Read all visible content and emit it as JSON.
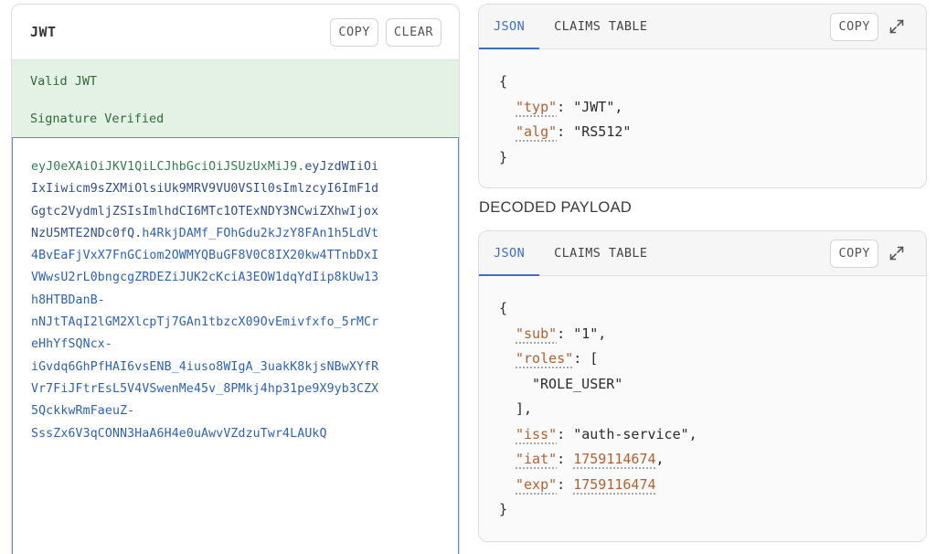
{
  "jwt_panel": {
    "title": "JWT",
    "copy_label": "COPY",
    "clear_label": "CLEAR",
    "status_valid": "Valid JWT",
    "status_signature": "Signature Verified",
    "token_lines": [
      {
        "parts": [
          {
            "text": "eyJ0eXAiOiJKV1QiLCJhbGciOiJSUzUxMiJ9",
            "kind": "header"
          },
          {
            "text": ".",
            "kind": "dot"
          },
          {
            "text": "eyJzdWIiOi",
            "kind": "payload"
          }
        ]
      },
      {
        "parts": [
          {
            "text": "IxIiwicm9sZXMiOlsiUk9MRV9VU0VSIl0sImlzcyI6ImF1d",
            "kind": "payload"
          }
        ]
      },
      {
        "parts": [
          {
            "text": "Ggtc2VydmljZSIsImlhdCI6MTc1OTExNDY3NCwiZXhwIjox",
            "kind": "payload"
          }
        ]
      },
      {
        "parts": [
          {
            "text": "NzU5MTE2NDc0fQ",
            "kind": "payload"
          },
          {
            "text": ".",
            "kind": "dot"
          },
          {
            "text": "h4RkjDAMf_FOhGdu2kJzY8FAn1h5LdVt",
            "kind": "sig"
          }
        ]
      },
      {
        "parts": [
          {
            "text": "4BvEaFjVxX7FnGCiom2OWMYQBuGF8V0C8IX20kw4TTnbDxI",
            "kind": "sig"
          }
        ]
      },
      {
        "parts": [
          {
            "text": "VWwsU2rL0bngcgZRDEZiJUK2cKciA3EOW1dqYdIip8kUw13",
            "kind": "sig"
          }
        ]
      },
      {
        "parts": [
          {
            "text": "h8HTBDanB-",
            "kind": "sig"
          }
        ]
      },
      {
        "parts": [
          {
            "text": "nNJtTAqI2lGM2XlcpTj7GAn1tbzcX09OvEmivfxfo_5rMCr",
            "kind": "sig"
          }
        ]
      },
      {
        "parts": [
          {
            "text": "eHhYfSQNcx-",
            "kind": "sig"
          }
        ]
      },
      {
        "parts": [
          {
            "text": "iGvdq6GhPfHAI6vsENB_4iuso8WIgA_3uakK8kjsNBwXYfR",
            "kind": "sig"
          }
        ]
      },
      {
        "parts": [
          {
            "text": "Vr7FiJFtrEsL5V4VSwenMe45v_8PMkj4hp31pe9X9yb3CZX",
            "kind": "sig"
          }
        ]
      },
      {
        "parts": [
          {
            "text": "5QckkwRmFaeuZ-",
            "kind": "sig"
          }
        ]
      },
      {
        "parts": [
          {
            "text": "SssZx6V3qCONN3HaA6H4e0uAwvVZdzuTwr4LAUkQ",
            "kind": "sig"
          }
        ]
      }
    ]
  },
  "header_card": {
    "tabs": [
      {
        "label": "JSON",
        "active": true
      },
      {
        "label": "CLAIMS TABLE",
        "active": false
      }
    ],
    "copy_label": "COPY",
    "lines": [
      {
        "indent": 0,
        "segs": [
          {
            "t": "{",
            "c": "p"
          }
        ]
      },
      {
        "indent": 1,
        "segs": [
          {
            "t": "\"typ\"",
            "c": "k"
          },
          {
            "t": ": \"JWT\",",
            "c": "p"
          }
        ]
      },
      {
        "indent": 1,
        "segs": [
          {
            "t": "\"alg\"",
            "c": "k"
          },
          {
            "t": ": \"RS512\"",
            "c": "p"
          }
        ]
      },
      {
        "indent": 0,
        "segs": [
          {
            "t": "}",
            "c": "p"
          }
        ]
      }
    ]
  },
  "payload_section_label": "DECODED PAYLOAD",
  "payload_card": {
    "tabs": [
      {
        "label": "JSON",
        "active": true
      },
      {
        "label": "CLAIMS TABLE",
        "active": false
      }
    ],
    "copy_label": "COPY",
    "lines": [
      {
        "indent": 0,
        "segs": [
          {
            "t": "{",
            "c": "p"
          }
        ]
      },
      {
        "indent": 1,
        "segs": [
          {
            "t": "\"sub\"",
            "c": "k"
          },
          {
            "t": ": \"1\",",
            "c": "p"
          }
        ]
      },
      {
        "indent": 1,
        "segs": [
          {
            "t": "\"roles\"",
            "c": "k"
          },
          {
            "t": ": [",
            "c": "p"
          }
        ]
      },
      {
        "indent": 2,
        "segs": [
          {
            "t": "\"ROLE_USER\"",
            "c": "p"
          }
        ]
      },
      {
        "indent": 1,
        "segs": [
          {
            "t": "],",
            "c": "p"
          }
        ]
      },
      {
        "indent": 1,
        "segs": [
          {
            "t": "\"iss\"",
            "c": "k"
          },
          {
            "t": ": \"auth-service\",",
            "c": "p"
          }
        ]
      },
      {
        "indent": 1,
        "segs": [
          {
            "t": "\"iat\"",
            "c": "k"
          },
          {
            "t": ": ",
            "c": "p"
          },
          {
            "t": "1759114674",
            "c": "n"
          },
          {
            "t": ",",
            "c": "p"
          }
        ]
      },
      {
        "indent": 1,
        "segs": [
          {
            "t": "\"exp\"",
            "c": "k"
          },
          {
            "t": ": ",
            "c": "p"
          },
          {
            "t": "1759116474",
            "c": "n"
          }
        ]
      },
      {
        "indent": 0,
        "segs": [
          {
            "t": "}",
            "c": "p"
          }
        ]
      }
    ]
  },
  "colors": {
    "accent_blue": "#3a6fc9",
    "valid_bg": "#e4f2e5",
    "valid_text": "#2f6b3a",
    "json_key": "#b1602e",
    "token_header": "#2f7e53",
    "token_payload": "#2f4e8e",
    "token_signature": "#2b62b6"
  },
  "icons": {
    "expand": "expand-arrows-icon"
  }
}
